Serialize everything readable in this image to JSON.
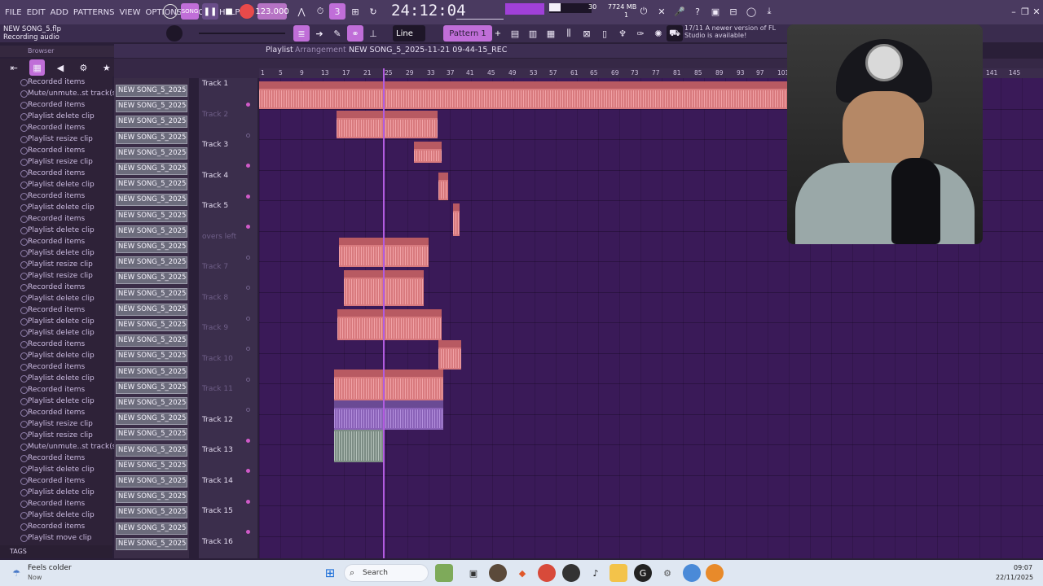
{
  "menu": [
    "FILE",
    "EDIT",
    "ADD",
    "PATTERNS",
    "VIEW",
    "OPTIONS",
    "TOOLS",
    "HELP"
  ],
  "transport": {
    "tempo": "123.000",
    "time": "24:12:04",
    "cpu_count": "30",
    "memory": "7724 MB",
    "mem_sub": "1",
    "snap": "Line",
    "pattern": "Pattern 1",
    "pattern_sep": "+"
  },
  "project": {
    "file": "NEW SONG_5.flp",
    "status": "Recording audio"
  },
  "notice": {
    "text": "17/11 A newer version of FL Studio is available!"
  },
  "browser": {
    "title": "Browser"
  },
  "playlist": {
    "title": "Playlist",
    "subtitle": "Arrangement",
    "clip_name": "NEW SONG_5_2025-11-21 09-44-15_REC"
  },
  "ruler_ticks": [
    "1",
    "5",
    "9",
    "13",
    "17",
    "21",
    "25",
    "29",
    "33",
    "37",
    "41",
    "45",
    "49",
    "53",
    "57",
    "61",
    "65",
    "69",
    "73",
    "77",
    "81",
    "85",
    "89",
    "93",
    "97",
    "101",
    "141",
    "145"
  ],
  "history": [
    "Recorded items",
    "Mute/unmute..st track(s)",
    "Recorded items",
    "Playlist delete clip",
    "Recorded items",
    "Playlist resize clip",
    "Recorded items",
    "Playlist resize clip",
    "Recorded items",
    "Playlist delete clip",
    "Recorded items",
    "Playlist delete clip",
    "Recorded items",
    "Playlist delete clip",
    "Recorded items",
    "Playlist delete clip",
    "Playlist resize clip",
    "Playlist resize clip",
    "Recorded items",
    "Playlist delete clip",
    "Recorded items",
    "Playlist delete clip",
    "Playlist delete clip",
    "Recorded items",
    "Playlist delete clip",
    "Recorded items",
    "Playlist delete clip",
    "Recorded items",
    "Playlist delete clip",
    "Recorded items",
    "Playlist resize clip",
    "Playlist resize clip",
    "Mute/unmute..st track(s)",
    "Recorded items",
    "Playlist delete clip",
    "Recorded items",
    "Playlist delete clip",
    "Recorded items",
    "Playlist delete clip",
    "Recorded items",
    "Playlist move clip"
  ],
  "pattern_clip_label": "NEW SONG_5_2025-11-2...",
  "pattern_clip_count": 30,
  "tracks": [
    {
      "name": "Track 1",
      "active": true
    },
    {
      "name": "Track 2",
      "active": false
    },
    {
      "name": "Track 3",
      "active": true
    },
    {
      "name": "Track 4",
      "active": true
    },
    {
      "name": "Track 5",
      "active": true
    },
    {
      "name": "overs left",
      "active": false
    },
    {
      "name": "Track 7",
      "active": false
    },
    {
      "name": "Track 8",
      "active": false
    },
    {
      "name": "Track 9",
      "active": false
    },
    {
      "name": "Track 10",
      "active": false
    },
    {
      "name": "Track 11",
      "active": false
    },
    {
      "name": "Track 12",
      "active": true
    },
    {
      "name": "Track 13",
      "active": true
    },
    {
      "name": "Track 14",
      "active": true
    },
    {
      "name": "Track 15",
      "active": true
    },
    {
      "name": "Track 16",
      "active": true
    }
  ],
  "audio_clips": [
    {
      "label": "free_jid_x_kendrick_lamar_x_j_cole_type_beat__the_arkive_003",
      "color": "red"
    },
    {
      "label": "trap_5_REC",
      "color": "red"
    },
    {
      "label": "",
      "color": "red"
    },
    {
      "label": "",
      "color": "red"
    },
    {
      "label": "",
      "color": "red"
    },
    {
      "label": "NEW SONG_5_202 09-00-37_REC",
      "color": "red"
    },
    {
      "label": "NEW SONG_ -45_REC",
      "color": "red"
    },
    {
      "label": "NEW SONG_5_2025-11-21 09-18-40_REC",
      "color": "red"
    },
    {
      "label": "NE_ C",
      "color": "red"
    },
    {
      "label": "NEW SONG_5_2025-11-21 09-31-33_REC",
      "color": "red"
    },
    {
      "label": "NEW SONG_5_2025-11-22 09-04-53_REC",
      "color": "purple"
    },
    {
      "label": "",
      "color": "grey"
    }
  ],
  "tags": {
    "label": "TAGS"
  },
  "weather": {
    "title": "Feels colder",
    "sub": "Now"
  },
  "search": {
    "placeholder": "Search"
  },
  "clock": {
    "time": "09:07",
    "date": "22/11/2025"
  },
  "colors": {
    "accent": "#b25ce0",
    "clip_red": "#d87a7e",
    "clip_purple": "#8a62b8",
    "grid_bg": "#3a1a58"
  }
}
